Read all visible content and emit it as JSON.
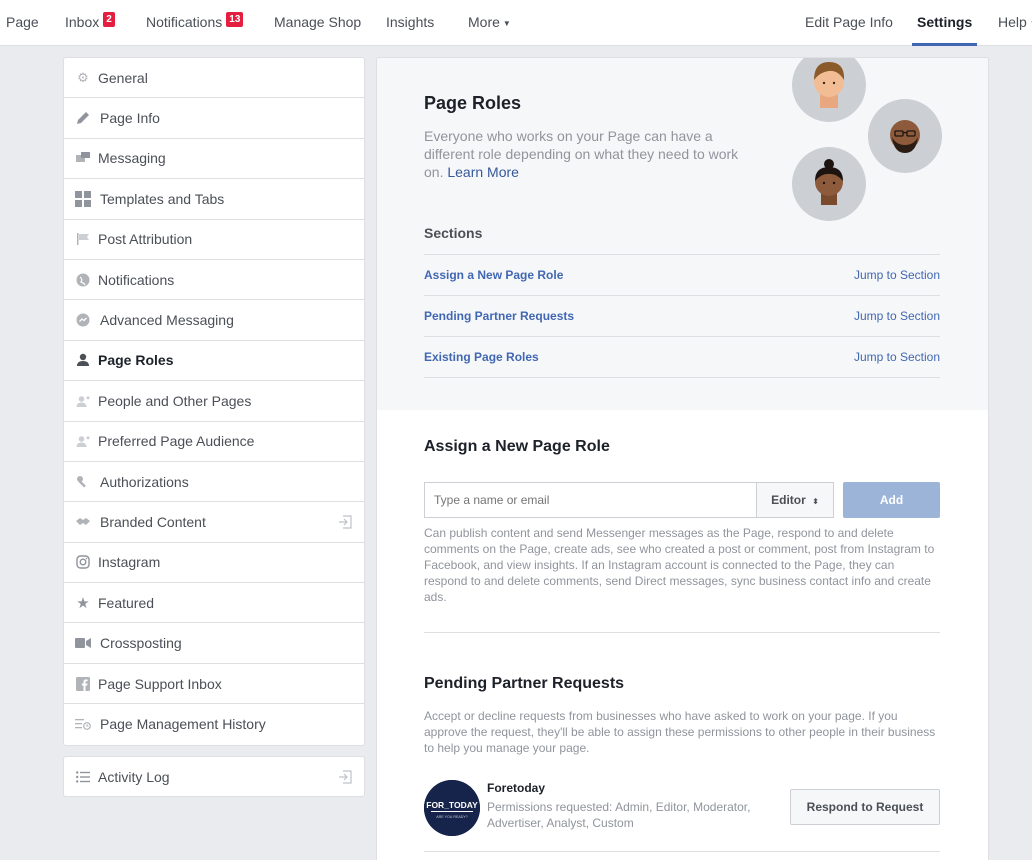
{
  "topnav": {
    "items": [
      {
        "label": "Page"
      },
      {
        "label": "Inbox",
        "badge": "2"
      },
      {
        "label": "Notifications",
        "badge": "13"
      },
      {
        "label": "Manage Shop"
      },
      {
        "label": "Insights"
      },
      {
        "label": "More"
      }
    ],
    "right": [
      {
        "label": "Edit Page Info"
      },
      {
        "label": "Settings"
      },
      {
        "label": "Help"
      }
    ]
  },
  "sidebar": {
    "items": [
      {
        "label": "General",
        "icon": "gear-icon"
      },
      {
        "label": "Page Info",
        "icon": "pencil-icon"
      },
      {
        "label": "Messaging",
        "icon": "chat-bubbles-icon"
      },
      {
        "label": "Templates and Tabs",
        "icon": "grid-icon"
      },
      {
        "label": "Post Attribution",
        "icon": "flag-icon"
      },
      {
        "label": "Notifications",
        "icon": "globe-icon"
      },
      {
        "label": "Advanced Messaging",
        "icon": "messenger-icon"
      },
      {
        "label": "Page Roles",
        "icon": "person-icon"
      },
      {
        "label": "People and Other Pages",
        "icon": "person-star-icon"
      },
      {
        "label": "Preferred Page Audience",
        "icon": "person-star-icon"
      },
      {
        "label": "Authorizations",
        "icon": "wrench-icon"
      },
      {
        "label": "Branded Content",
        "icon": "handshake-icon"
      },
      {
        "label": "Instagram",
        "icon": "instagram-icon"
      },
      {
        "label": "Featured",
        "icon": "star-icon"
      },
      {
        "label": "Crossposting",
        "icon": "video-camera-icon"
      },
      {
        "label": "Page Support Inbox",
        "icon": "facebook-icon"
      },
      {
        "label": "Page Management History",
        "icon": "history-icon"
      }
    ],
    "activity_log": {
      "label": "Activity Log",
      "icon": "list-icon"
    }
  },
  "main": {
    "title": "Page Roles",
    "intro": "Everyone who works on your Page can have a different role depending on what they need to work on.",
    "learn_more": "Learn More",
    "sections_title": "Sections",
    "sections": [
      {
        "label": "Assign a New Page Role",
        "jump": "Jump to Section"
      },
      {
        "label": "Pending Partner Requests",
        "jump": "Jump to Section"
      },
      {
        "label": "Existing Page Roles",
        "jump": "Jump to Section"
      }
    ],
    "assign": {
      "title": "Assign a New Page Role",
      "placeholder": "Type a name or email",
      "role": "Editor",
      "add_label": "Add",
      "description": "Can publish content and send Messenger messages as the Page, respond to and delete comments on the Page, create ads, see who created a post or comment, post from Instagram to Facebook, and view insights. If an Instagram account is connected to the Page, they can respond to and delete comments, send Direct messages, sync business contact info and create ads."
    },
    "pending": {
      "title": "Pending Partner Requests",
      "description": "Accept or decline requests from businesses who have asked to work on your page. If you approve the request, they'll be able to assign these permissions to other people in their business to help you manage your page.",
      "partner": {
        "name": "Foretoday",
        "logo_text": "FOR_TODAY",
        "logo_sub": "ARE YOU READY?",
        "permissions": "Permissions requested: Admin, Editor, Moderator, Advertiser, Analyst, Custom"
      },
      "respond_label": "Respond to Request"
    }
  },
  "colors": {
    "accent": "#4267b2",
    "badge": "#e41e3f",
    "add_button": "#9cb4d8"
  }
}
